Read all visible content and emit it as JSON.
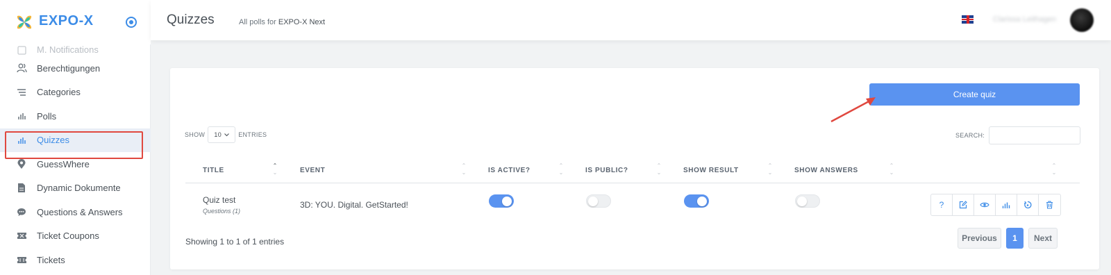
{
  "brand": {
    "name": "EXPO-X"
  },
  "sidebar": {
    "items": [
      {
        "label": "M. Notifications",
        "icon": "notification-icon"
      },
      {
        "label": "Berechtigungen",
        "icon": "users-icon"
      },
      {
        "label": "Categories",
        "icon": "list-icon"
      },
      {
        "label": "Polls",
        "icon": "bar-chart-icon"
      },
      {
        "label": "Quizzes",
        "icon": "bar-chart-icon"
      },
      {
        "label": "GuessWhere",
        "icon": "map-pin-icon"
      },
      {
        "label": "Dynamic Dokumente",
        "icon": "document-icon"
      },
      {
        "label": "Questions & Answers",
        "icon": "chat-icon"
      },
      {
        "label": "Ticket Coupons",
        "icon": "ticket-icon"
      },
      {
        "label": "Tickets",
        "icon": "ticket-icon"
      }
    ],
    "active": "Quizzes"
  },
  "header": {
    "title": "Quizzes",
    "subtitle_prefix": "All polls for",
    "subtitle_event": "EXPO-X Next",
    "user_name": "Clarissa Leithagen"
  },
  "toolbar": {
    "create_label": "Create quiz"
  },
  "table_controls": {
    "show_label": "SHOW",
    "page_size": "10",
    "entries_label": "ENTRIES",
    "search_label": "SEARCH:",
    "search_value": ""
  },
  "table": {
    "columns": [
      "TITLE",
      "EVENT",
      "IS ACTIVE?",
      "IS PUBLIC?",
      "SHOW RESULT",
      "SHOW ANSWERS"
    ],
    "rows": [
      {
        "title": "Quiz test",
        "questions": "Questions (1)",
        "event": "3D: YOU. Digital. GetStarted!",
        "is_active": true,
        "is_public": false,
        "show_result": true,
        "show_answers": false
      }
    ]
  },
  "pagination": {
    "info": "Showing 1 to 1 of 1 entries",
    "previous": "Previous",
    "current": "1",
    "next": "Next"
  },
  "colors": {
    "accent": "#5a93f0",
    "brand": "#3c8ce7",
    "highlight": "#e0483f"
  }
}
